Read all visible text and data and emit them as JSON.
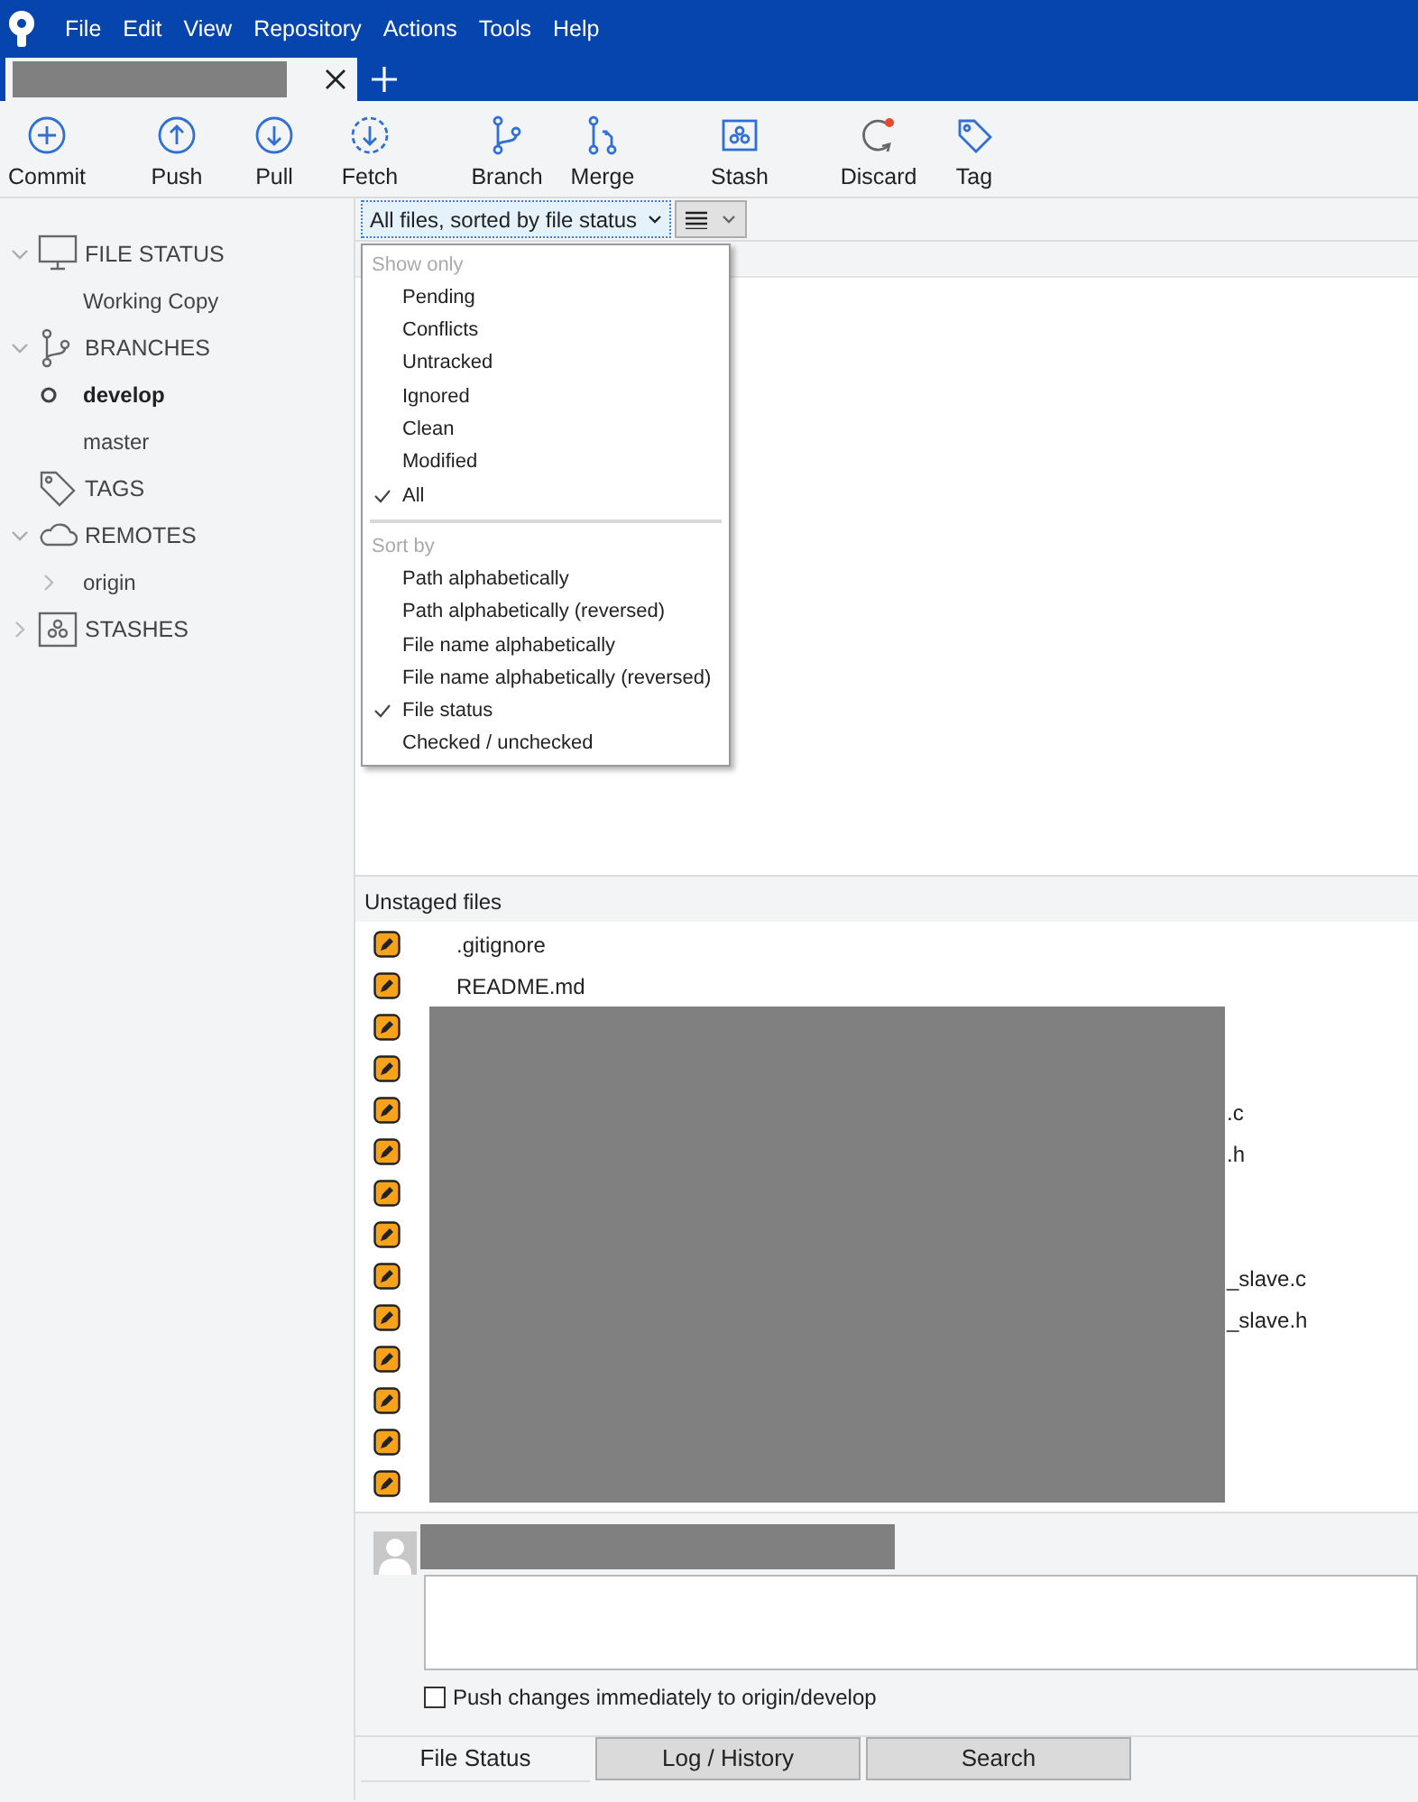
{
  "menu_bar": [
    "File",
    "Edit",
    "View",
    "Repository",
    "Actions",
    "Tools",
    "Help"
  ],
  "tabs": [
    {
      "title_redacted": true,
      "selected": true
    }
  ],
  "toolbar": [
    {
      "kind": "commit",
      "label": "Commit"
    },
    {
      "kind": "push",
      "label": "Push"
    },
    {
      "kind": "pull",
      "label": "Pull"
    },
    {
      "kind": "fetch",
      "label": "Fetch"
    },
    {
      "kind": "branch",
      "label": "Branch"
    },
    {
      "kind": "merge",
      "label": "Merge"
    },
    {
      "kind": "stash",
      "label": "Stash"
    },
    {
      "kind": "discard",
      "label": "Discard"
    },
    {
      "kind": "tag",
      "label": "Tag"
    }
  ],
  "sidebar": [
    {
      "kind": "monitor",
      "label": "FILE STATUS",
      "expanded": true,
      "children": [
        {
          "label": "Working Copy",
          "current": false
        }
      ]
    },
    {
      "kind": "branch",
      "label": "BRANCHES",
      "expanded": true,
      "children": [
        {
          "label": "develop",
          "current": true
        },
        {
          "label": "master",
          "current": false
        }
      ]
    },
    {
      "kind": "tag",
      "label": "TAGS"
    },
    {
      "kind": "cloud",
      "label": "REMOTES",
      "expanded": true,
      "children": [
        {
          "label": "origin",
          "current": false,
          "expanded": false
        }
      ]
    },
    {
      "kind": "stash",
      "label": "STASHES",
      "expanded": false
    }
  ],
  "filter": {
    "value": "All files, sorted by file status"
  },
  "filter_menu": [
    {
      "heading": "Show only",
      "items": [
        {
          "label": "Pending",
          "checked": false
        },
        {
          "label": "Conflicts",
          "checked": false
        },
        {
          "label": "Untracked",
          "checked": false
        },
        {
          "label": "Ignored",
          "checked": false
        },
        {
          "label": "Clean",
          "checked": false
        },
        {
          "label": "Modified",
          "checked": false
        },
        {
          "label": "All",
          "checked": true
        }
      ]
    },
    {
      "heading": "Sort by",
      "items": [
        {
          "label": "Path alphabetically",
          "checked": false
        },
        {
          "label": "Path alphabetically (reversed)",
          "checked": false
        },
        {
          "label": "File name alphabetically",
          "checked": false
        },
        {
          "label": "File name alphabetically (reversed)",
          "checked": false
        },
        {
          "label": "File status",
          "checked": true
        },
        {
          "label": "Checked / unchecked",
          "checked": false
        }
      ]
    }
  ],
  "unstaged": {
    "heading": "Unstaged files",
    "files": [
      {
        "kind": "modified",
        "name": ".gitignore"
      },
      {
        "kind": "modified",
        "name": "README.md"
      },
      {
        "kind": "modified"
      },
      {
        "kind": "modified"
      },
      {
        "kind": "modified",
        "tail": ".c"
      },
      {
        "kind": "modified",
        "tail": ".h"
      },
      {
        "kind": "modified"
      },
      {
        "kind": "modified"
      },
      {
        "kind": "modified",
        "tail": "_slave.c"
      },
      {
        "kind": "modified",
        "tail": "_slave.h"
      },
      {
        "kind": "modified"
      },
      {
        "kind": "modified"
      },
      {
        "kind": "modified"
      },
      {
        "kind": "modified"
      }
    ]
  },
  "commit": {
    "push_option": {
      "label": "Push changes immediately to origin/develop",
      "checked": false
    }
  },
  "bottom_tabs": [
    {
      "label": "File Status",
      "selected": true
    },
    {
      "label": "Log / History",
      "selected": false
    },
    {
      "label": "Search",
      "selected": false
    }
  ]
}
